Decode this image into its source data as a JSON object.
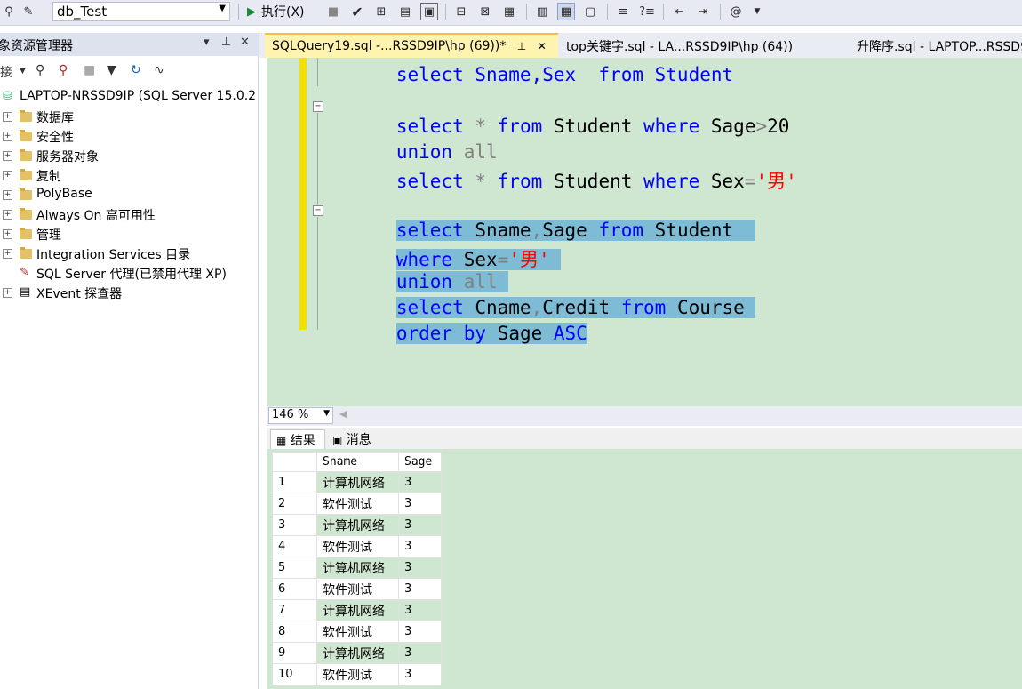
{
  "toolbar": {
    "database": "db_Test",
    "execute_label": "执行(X)"
  },
  "object_explorer": {
    "title": "象资源管理器",
    "connect_label": "接",
    "tree": [
      {
        "label": "LAPTOP-NRSSD9IP (SQL Server 15.0.2",
        "type": "server"
      },
      {
        "label": "数据库",
        "type": "folder"
      },
      {
        "label": "安全性",
        "type": "folder"
      },
      {
        "label": "服务器对象",
        "type": "folder"
      },
      {
        "label": "复制",
        "type": "folder"
      },
      {
        "label": "PolyBase",
        "type": "folder"
      },
      {
        "label": "Always On 高可用性",
        "type": "folder"
      },
      {
        "label": "管理",
        "type": "folder"
      },
      {
        "label": "Integration Services 目录",
        "type": "folder"
      },
      {
        "label": "SQL Server 代理(已禁用代理 XP)",
        "type": "agent"
      },
      {
        "label": "XEvent 探查器",
        "type": "xevent"
      }
    ]
  },
  "tabs": [
    {
      "label": "SQLQuery19.sql -...RSSD9IP\\hp (69))*",
      "active": true
    },
    {
      "label": "top关键字.sql - LA...RSSD9IP\\hp (64))",
      "active": false
    },
    {
      "label": "升降序.sql - LAPTOP...RSSD9",
      "active": false
    }
  ],
  "editor": {
    "partial_line": "select Sname,Sex  from Student",
    "block1": {
      "l1": {
        "kw1": "select",
        "t1": " * ",
        "kw2": "from",
        "t2": " Student ",
        "kw3": "where",
        "t3": " Sage",
        "g": ">",
        "t4": "20"
      },
      "l2": {
        "kw1": "union",
        "g": " all"
      },
      "l3": {
        "kw1": "select",
        "t1": " * ",
        "kw2": "from",
        "t2": " Student ",
        "kw3": "where",
        "t3": " Sex",
        "g": "=",
        "s": "'男'"
      }
    },
    "block2": {
      "l1": {
        "kw1": "select",
        "t1": " Sname",
        "g": ",",
        "t2": "Sage ",
        "kw2": "from",
        "t3": " Student  "
      },
      "l2": {
        "kw1": "where",
        "t1": " Sex",
        "g": "=",
        "s": "'男' "
      },
      "l3": {
        "kw1": "union",
        "g": " all "
      },
      "l4": {
        "kw1": "select",
        "t1": " Cname",
        "g": ",",
        "t2": "Credit ",
        "kw2": "from",
        "t3": " Course "
      },
      "l5": {
        "kw1": "order",
        "t1": " ",
        "kw2": "by",
        "t2": " Sage ",
        "kw3": "ASC"
      }
    }
  },
  "zoom": "146 %",
  "results_tabs": [
    "结果",
    "消息"
  ],
  "grid": {
    "columns": [
      "Sname",
      "Sage"
    ],
    "rows": [
      [
        "1",
        "计算机网络",
        "3"
      ],
      [
        "2",
        "软件测试",
        "3"
      ],
      [
        "3",
        "计算机网络",
        "3"
      ],
      [
        "4",
        "软件测试",
        "3"
      ],
      [
        "5",
        "计算机网络",
        "3"
      ],
      [
        "6",
        "软件测试",
        "3"
      ],
      [
        "7",
        "计算机网络",
        "3"
      ],
      [
        "8",
        "软件测试",
        "3"
      ],
      [
        "9",
        "计算机网络",
        "3"
      ],
      [
        "10",
        "软件测试",
        "3"
      ]
    ]
  }
}
